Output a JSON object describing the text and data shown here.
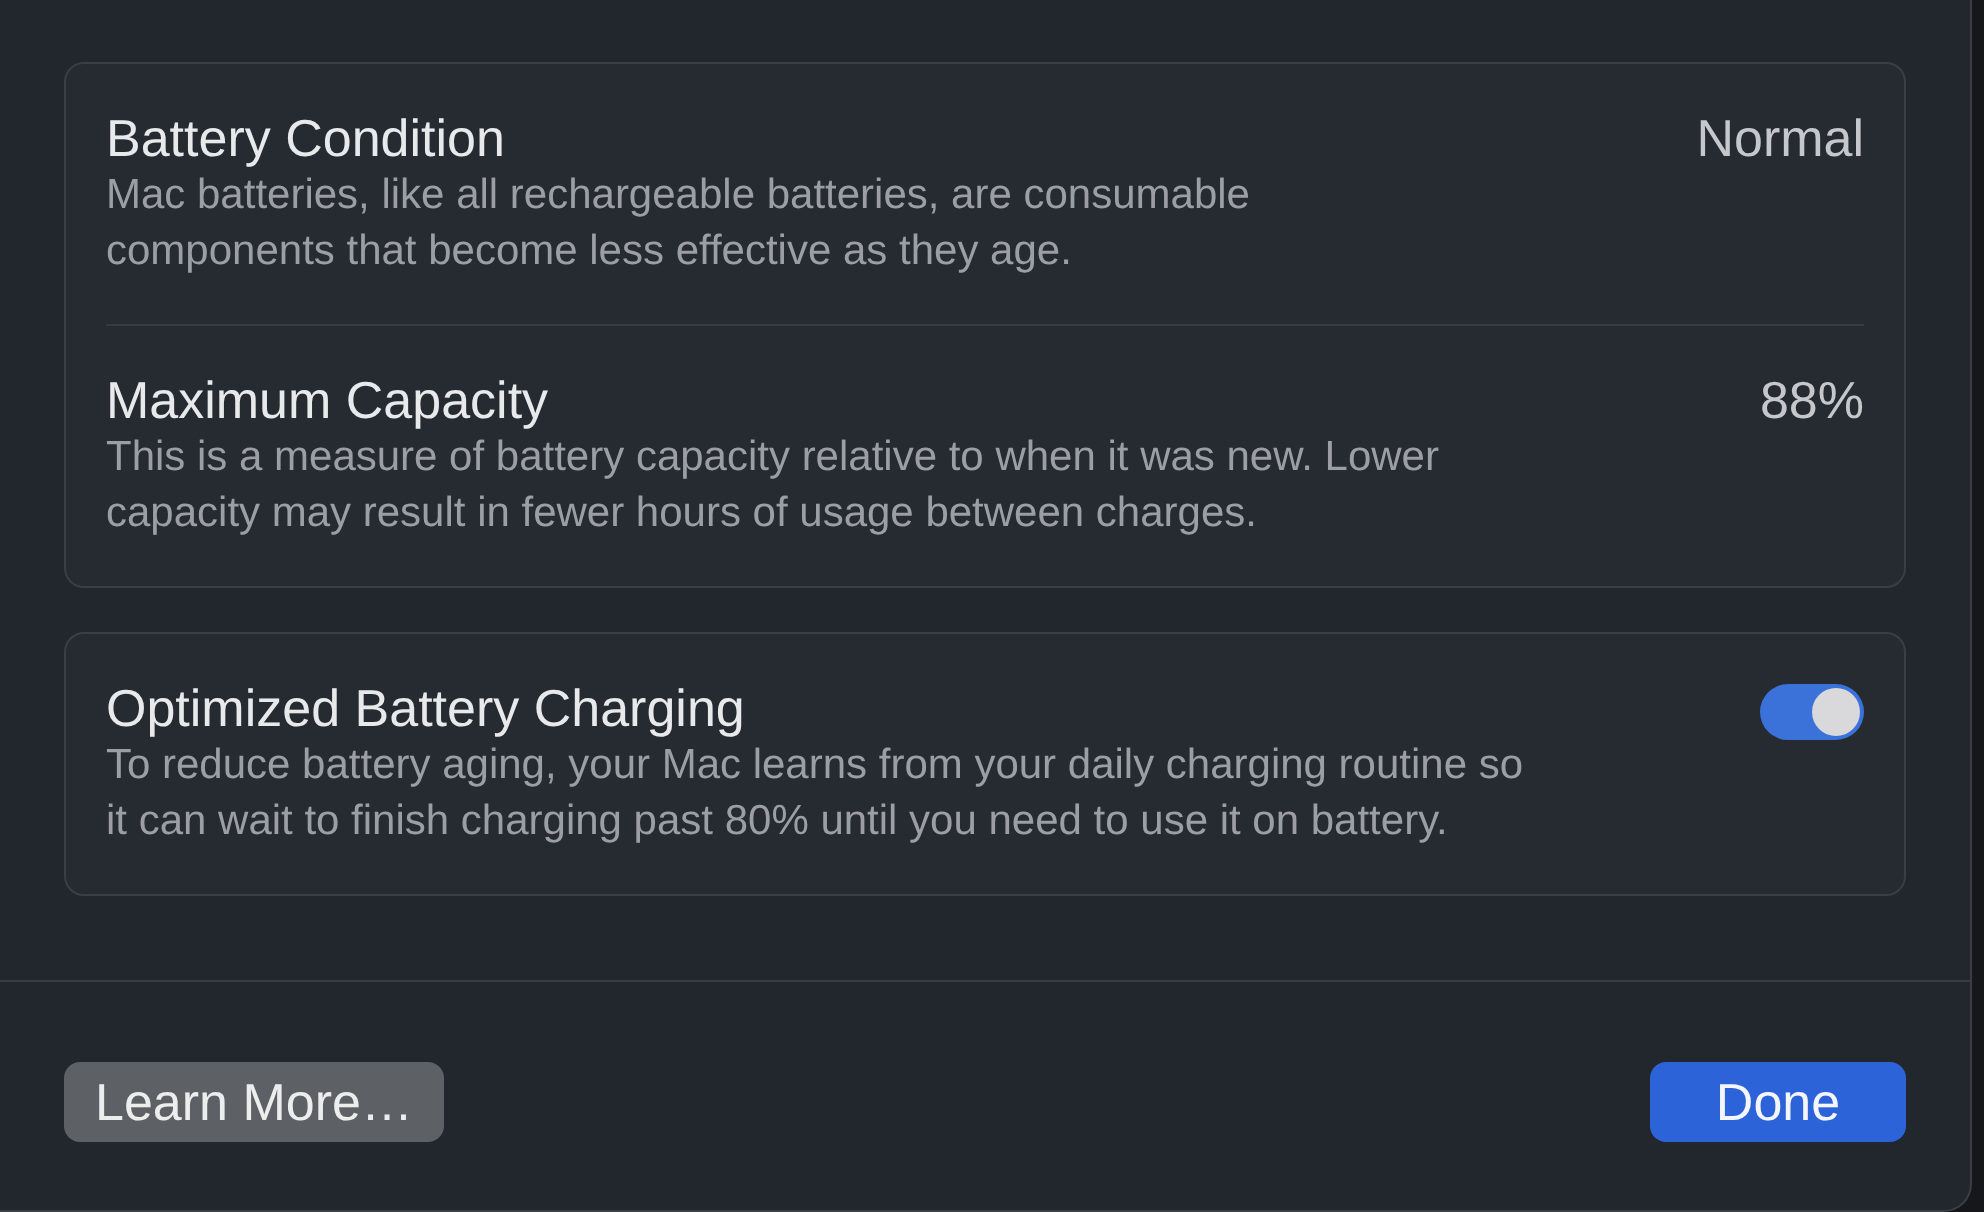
{
  "sections": [
    {
      "rows": [
        {
          "kind": "value",
          "title": "Battery Condition",
          "description": "Mac batteries, like all rechargeable batteries, are consumable components that become less effective as they age.",
          "value": "Normal"
        },
        {
          "kind": "value",
          "title": "Maximum Capacity",
          "description": "This is a measure of battery capacity relative to when it was new. Lower capacity may result in fewer hours of usage between charges.",
          "value": "88%"
        }
      ]
    },
    {
      "rows": [
        {
          "kind": "toggle",
          "title": "Optimized Battery Charging",
          "description": "To reduce battery aging, your Mac learns from your daily charging routine so it can wait to finish charging past 80% until you need to use it on battery.",
          "on": true
        }
      ]
    }
  ],
  "buttons": [
    {
      "kind": "secondary",
      "label": "Learn More…"
    },
    {
      "kind": "primary",
      "label": "Done"
    }
  ]
}
